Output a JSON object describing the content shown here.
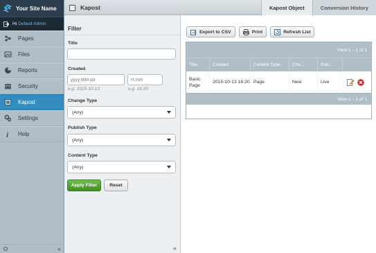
{
  "app": {
    "site_name": "Your Site Name",
    "greeting": "Hi",
    "user_name": "Default Admin"
  },
  "menu": {
    "items": [
      {
        "label": "Pages",
        "icon": "pages-icon"
      },
      {
        "label": "Files",
        "icon": "files-icon"
      },
      {
        "label": "Reports",
        "icon": "reports-icon"
      },
      {
        "label": "Security",
        "icon": "security-icon"
      },
      {
        "label": "Kapost",
        "icon": "kapost-icon",
        "current": true
      },
      {
        "label": "Settings",
        "icon": "settings-icon"
      },
      {
        "label": "Help",
        "icon": "help-icon"
      }
    ],
    "collapse_glyph": "«"
  },
  "header": {
    "title": "Kapost",
    "tabs": [
      {
        "label": "Kapost Object",
        "active": true
      },
      {
        "label": "Conversion History",
        "active": false
      }
    ]
  },
  "filter": {
    "heading": "Filter",
    "title_label": "Title",
    "title_value": "",
    "created_label": "Created",
    "date_placeholder": "yyyy-MM-dd",
    "time_placeholder": "H:mm",
    "date_hint": "e.g. 2015-10-13",
    "time_hint": "e.g. 16:20",
    "change_type_label": "Change Type",
    "change_type_value": "(Any)",
    "publish_type_label": "Publish Type",
    "publish_type_value": "(Any)",
    "content_type_label": "Content Type",
    "content_type_value": "(Any)",
    "apply_label": "Apply Filter",
    "reset_label": "Reset",
    "collapse_glyph": "«"
  },
  "toolbar": {
    "export_label": "Export to CSV",
    "print_label": "Print",
    "refresh_label": "Refresh List"
  },
  "grid": {
    "pager_text": "View 1 – 1 of 1",
    "footer_text": "View 1 – 1 of 1",
    "columns": [
      "Title",
      "Created",
      "Content Type",
      "Cha…",
      "Pub…"
    ],
    "rows": [
      {
        "title": "Basic Page",
        "created": "2015-10-13 16:20",
        "content_type": "Page",
        "change_type": "New",
        "publish_type": "Live"
      }
    ]
  },
  "colors": {
    "accent": "#338dc1",
    "sidebar": "#b0bec7",
    "brand_bar": "#2c3d4d",
    "apply_button": "#4fa62b"
  }
}
